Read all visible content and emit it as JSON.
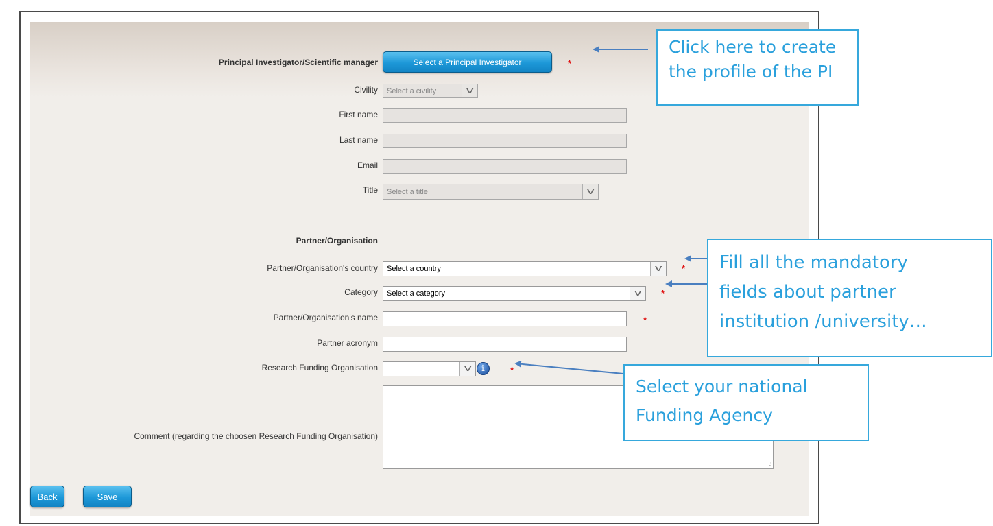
{
  "pi_section": {
    "label": "Principal Investigator/Scientific manager",
    "select_button": "Select a Principal Investigator",
    "required_mark": "*"
  },
  "pi_fields": {
    "civility_label": "Civility",
    "civility_value": "Select a civility",
    "first_name_label": "First name",
    "first_name_value": "",
    "last_name_label": "Last name",
    "last_name_value": "",
    "email_label": "Email",
    "email_value": "",
    "title_label": "Title",
    "title_value": "Select a title"
  },
  "partner_section": {
    "heading": "Partner/Organisation",
    "country_label": "Partner/Organisation's country",
    "country_value": "Select a country",
    "category_label": "Category",
    "category_value": "Select a category",
    "name_label": "Partner/Organisation's name",
    "name_value": "",
    "acronym_label": "Partner acronym",
    "acronym_value": "",
    "rfo_label": "Research Funding Organisation",
    "rfo_value": "",
    "info_icon_glyph": "i",
    "comment_label": "Comment (regarding the choosen Research Funding Organisation)",
    "comment_value": ""
  },
  "footer": {
    "back_label": "Back",
    "save_label": "Save"
  },
  "callouts": {
    "pi_profile": [
      "Click here to create",
      "the profile of the PI"
    ],
    "mandatory_fields": [
      "Fill all the mandatory",
      "fields about partner",
      "institution /university…"
    ],
    "funding_agency": [
      "Select your national",
      "Funding Agency"
    ]
  },
  "colors": {
    "button_blue": "#1d98d8",
    "callout_blue": "#2aa0dc",
    "arrow_blue": "#4a7fc0",
    "required_red": "#e01010"
  }
}
